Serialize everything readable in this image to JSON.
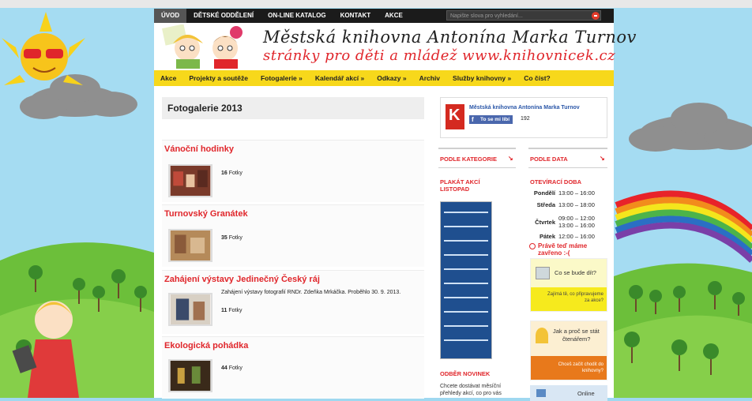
{
  "topbar": {
    "items": [
      {
        "label": "ÚVOD",
        "active": true
      },
      {
        "label": "DĚTSKÉ ODDĚLENÍ"
      },
      {
        "label": "ON-LINE KATALOG"
      },
      {
        "label": "KONTAKT"
      },
      {
        "label": "AKCE"
      }
    ],
    "search_placeholder": "Napište slova pro vyhledání..."
  },
  "header": {
    "title": "Městská knihovna Antonína Marka Turnov",
    "subtitle": "stránky pro děti a mládež www.knihovnicek.cz"
  },
  "nav": {
    "items": [
      "Akce",
      "Projekty a soutěže",
      "Fotogalerie »",
      "Kalendář akcí »",
      "Odkazy »",
      "Archiv",
      "Služby knihovny »",
      "Co číst?"
    ]
  },
  "main": {
    "page_title": "Fotogalerie 2013",
    "galleries": [
      {
        "title": "Vánoční hodinky",
        "count": "16",
        "unit": "Fotky",
        "description": ""
      },
      {
        "title": "Turnovský Granátek",
        "count": "35",
        "unit": "Fotky",
        "description": ""
      },
      {
        "title": "Zahájení výstavy Jedinečný Český ráj",
        "count": "11",
        "unit": "Fotky",
        "description": "Zahájení výstavy fotografií RNDr. Zdeňka Mrkáčka. Proběhlo 30. 9. 2013."
      },
      {
        "title": "Ekologická pohádka",
        "count": "44",
        "unit": "Fotky",
        "description": ""
      }
    ]
  },
  "sidebar": {
    "facebook": {
      "logo_letter": "K",
      "page_name": "Městská knihovna Antonína Marka Turnov",
      "like_label": "To se mi líbí",
      "like_count": "192"
    },
    "by_category": "PODLE KATEGORIE",
    "by_date": "PODLE DATA",
    "poster_title_1": "PLAKÁT AKCÍ",
    "poster_title_2": "LISTOPAD",
    "hours_title": "OTEVÍRACÍ DOBA",
    "hours": [
      {
        "day": "Pondělí",
        "time": "13:00 – 16:00"
      },
      {
        "day": "Středa",
        "time": "13:00 – 18:00"
      },
      {
        "day": "Čtvrtek",
        "time": "09:00 – 12:00",
        "time2": "13:00 – 16:00"
      },
      {
        "day": "Pátek",
        "time": "12:00 – 16:00"
      }
    ],
    "closed_line1": "Právě teď máme",
    "closed_line2": "zavřeno :-(",
    "promo1_title": "Co se bude dít?",
    "promo1_sub1": "Zajímá tě, co připravujeme",
    "promo1_sub2": "za akce?",
    "promo2_title1": "Jak a proč se stát",
    "promo2_title2": "čtenářem?",
    "promo2_sub1": "Chceš začít chodit do",
    "promo2_sub2": "knihovny?",
    "promo3_title": "Online",
    "newsletter_title": "ODBĚR NOVINEK",
    "newsletter_text1": "Chcete dostávat měsíční",
    "newsletter_text2": "přehledy akcí, co pro vás"
  },
  "colors": {
    "accent": "#e0262b",
    "nav_yellow": "#f7d81b",
    "topbar": "#1b1b1b",
    "sky": "#9fd8f0",
    "grass": "#6cbf3a"
  }
}
